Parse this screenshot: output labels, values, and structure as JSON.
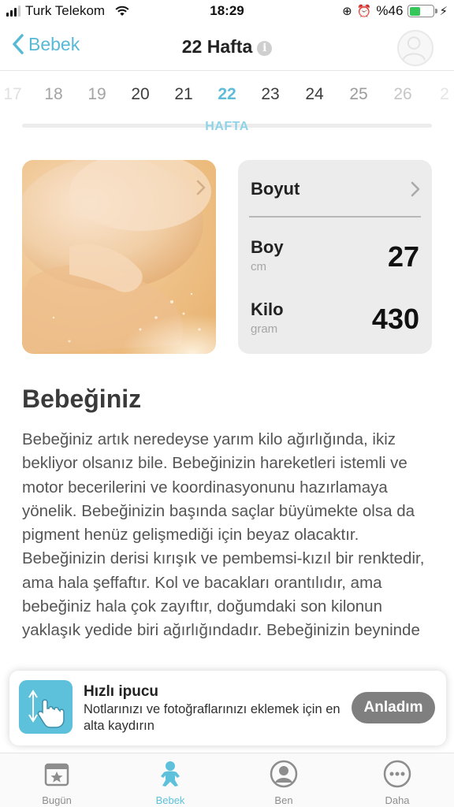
{
  "status_bar": {
    "carrier": "Turk Telekom",
    "time": "18:29",
    "battery": "%46",
    "battery_level": 0.46
  },
  "nav": {
    "back_label": "Bebek",
    "title": "22 Hafta",
    "info_glyph": "i"
  },
  "weeks": {
    "items": [
      "17",
      "18",
      "19",
      "20",
      "21",
      "22",
      "23",
      "24",
      "25",
      "26",
      "2"
    ],
    "active": "22",
    "label": "HAFTA"
  },
  "size_card": {
    "title": "Boyut",
    "length": {
      "label": "Boy",
      "unit": "cm",
      "value": "27"
    },
    "weight": {
      "label": "Kilo",
      "unit": "gram",
      "value": "430"
    }
  },
  "article": {
    "heading": "Bebeğiniz",
    "body": "Bebeğiniz artık neredeyse yarım kilo ağırlığında, ikiz bekliyor olsanız bile. Bebeğinizin hareketleri istemli ve motor becerilerini ve koordinasyonunu hazırlamaya yönelik. Bebeğinizin başında saçlar büyümekte olsa da pigment henüz gelişmediği için beyaz olacaktır. Bebeğinizin derisi kırışık ve pembemsi-kızıl bir renktedir, ama hala şeffaftır. Kol ve bacakları orantılıdır, ama bebeğiniz hala çok zayıftır, doğumdaki son kilonun yaklaşık yedide biri ağırlığındadır. Bebeğinizin beyninde"
  },
  "tip": {
    "title": "Hızlı ipucu",
    "text": "Notlarınızı ve fotoğraflarınızı eklemek için en alta kaydırın",
    "button": "Anladım"
  },
  "tabs": [
    {
      "label": "Bugün",
      "icon": "calendar-star-icon"
    },
    {
      "label": "Bebek",
      "icon": "baby-icon",
      "active": true
    },
    {
      "label": "Ben",
      "icon": "person-icon"
    },
    {
      "label": "Daha",
      "icon": "more-icon"
    }
  ],
  "colors": {
    "accent": "#5ec1dc",
    "card_bg": "#ececec",
    "button_gray": "#7f7f7f"
  }
}
